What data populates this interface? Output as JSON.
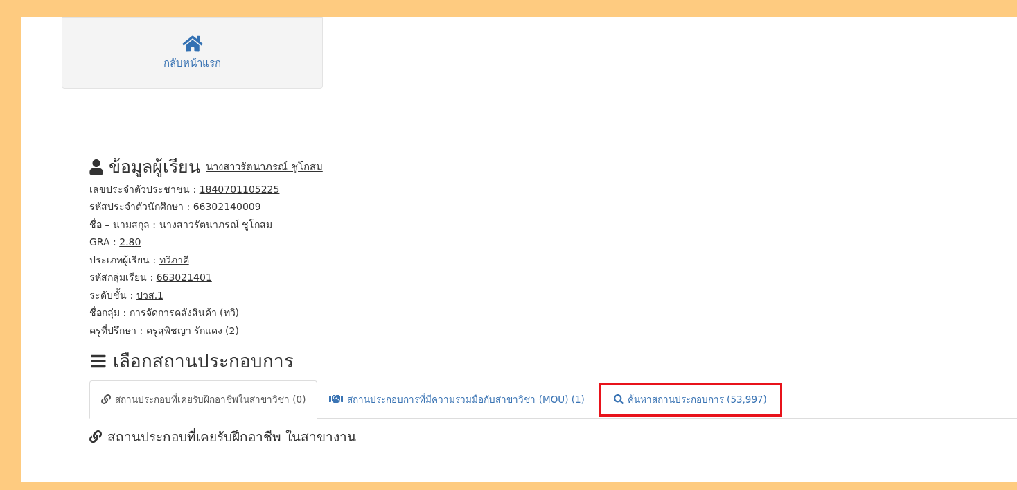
{
  "home_button": {
    "label": "กลับหน้าแรก"
  },
  "student": {
    "title": "ข้อมูลผู้เรียน",
    "name": "นางสาวรัตนาภรณ์ ชูโกสม",
    "fields": [
      {
        "label": "เลขประจำตัวประชาชน :",
        "value": "1840701105225"
      },
      {
        "label": "รหัสประจำตัวนักศึกษา :",
        "value": "66302140009"
      },
      {
        "label": "ชื่อ – นามสกุล :",
        "value": "นางสาวรัตนาภรณ์ ชูโกสม"
      },
      {
        "label": "GRA :",
        "value": "2.80"
      },
      {
        "label": "ประเภทผู้เรียน :",
        "value": "ทวิภาคี"
      },
      {
        "label": "รหัสกลุ่มเรียน :",
        "value": "663021401"
      },
      {
        "label": "ระดับชั้น :",
        "value": "ปวส.1"
      },
      {
        "label": "ชื่อกลุ่ม :",
        "value": "การจัดการคลังสินค้า (ทวิ)"
      },
      {
        "label": "ครูที่ปรึกษา :",
        "value": "ครูสุพิชญา รักแดง",
        "suffix": "(2)"
      }
    ]
  },
  "workplace": {
    "title": "เลือกสถานประกอบการ",
    "tabs": [
      {
        "kind": "link",
        "label": "สถานประกอบที่เคยรับฝึกอาชีพในสาขาวิชา (0)",
        "selected": true,
        "highlighted": false
      },
      {
        "kind": "handshake",
        "label": "สถานประกอบการที่มีความร่วมมือกับสาขาวิชา (MOU) (1)",
        "selected": false,
        "highlighted": false
      },
      {
        "kind": "search",
        "label": "ค้นหาสถานประกอบการ (53,997)",
        "selected": false,
        "highlighted": true
      }
    ],
    "panel_title": "สถานประกอบที่เคยรับฝึกอาชีพ ในสาขางาน"
  }
}
